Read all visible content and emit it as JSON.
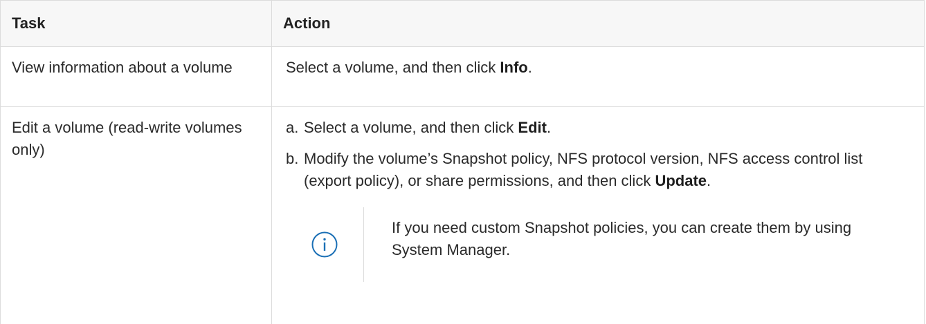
{
  "table": {
    "headers": {
      "task": "Task",
      "action": "Action"
    },
    "rows": [
      {
        "task": "View information about a volume",
        "action": {
          "pre": "Select a volume, and then click ",
          "bold": "Info",
          "post": "."
        }
      },
      {
        "task": "Edit a volume (read-write volumes only)",
        "steps": [
          {
            "letter": "a.",
            "pre": "Select a volume, and then click ",
            "bold": "Edit",
            "post": "."
          },
          {
            "letter": "b.",
            "pre": "Modify the volume’s Snapshot policy, NFS protocol version, NFS access control list (export policy), or share permissions, and then click ",
            "bold": "Update",
            "post": "."
          }
        ],
        "note": {
          "icon": "info-icon",
          "text": "If you need custom Snapshot policies, you can create them by using System Manager."
        }
      }
    ]
  },
  "colors": {
    "border": "#dcdcdc",
    "header_bg": "#f7f7f7",
    "info_icon": "#1a6fb5"
  }
}
